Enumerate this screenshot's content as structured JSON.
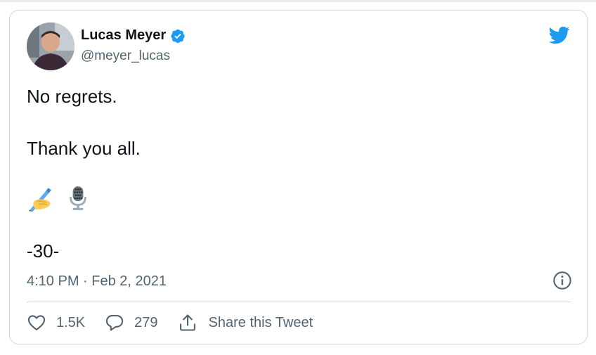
{
  "author": {
    "display_name": "Lucas Meyer",
    "handle": "@meyer_lucas",
    "verified": true
  },
  "tweet": {
    "lines": [
      "No regrets.",
      "",
      "Thank you all."
    ],
    "emojis": [
      "writing-hand-emoji",
      "microphone-emoji"
    ],
    "closing": "-30-",
    "timestamp": "4:10 PM · Feb 2, 2021"
  },
  "actions": {
    "likes": "1.5K",
    "replies": "279",
    "share_label": "Share this Tweet"
  },
  "colors": {
    "twitter_blue": "#1d9bf0",
    "border": "#cfd9de",
    "muted_text": "#536471"
  }
}
